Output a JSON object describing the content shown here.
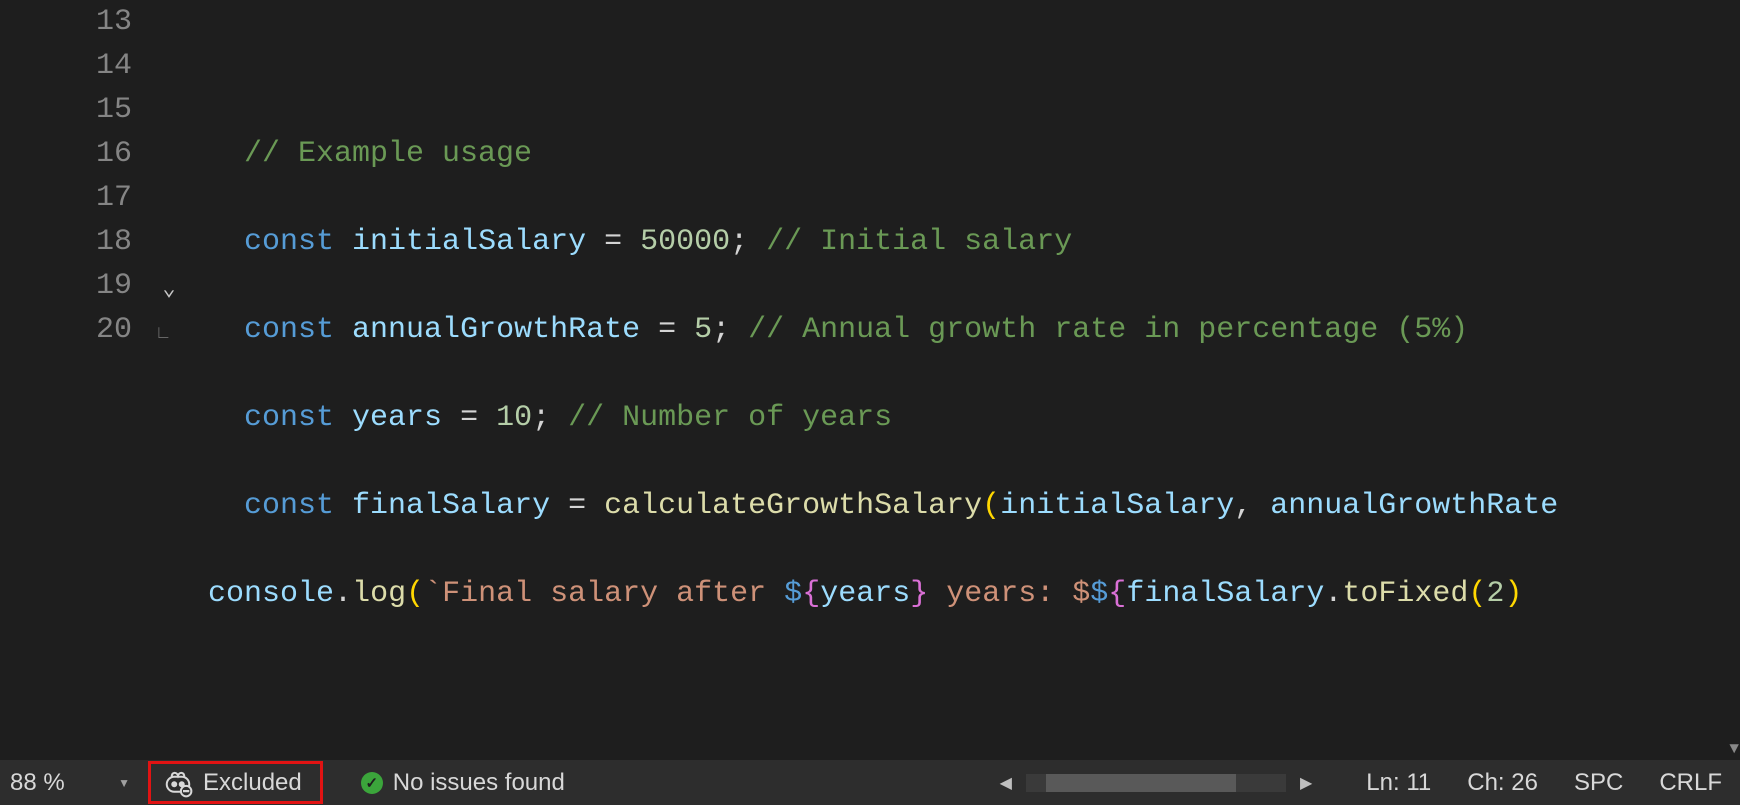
{
  "code": {
    "lines": [
      {
        "n": "13"
      },
      {
        "n": "14"
      },
      {
        "n": "15"
      },
      {
        "n": "16"
      },
      {
        "n": "17"
      },
      {
        "n": "18"
      },
      {
        "n": "19"
      },
      {
        "n": "20"
      }
    ],
    "l14_comment": "// Example usage",
    "l15_const": "const",
    "l15_name": "initialSalary",
    "l15_eq": " = ",
    "l15_val": "50000",
    "l15_semi": ";",
    "l15_cm": " // Initial salary",
    "l16_const": "const",
    "l16_name": "annualGrowthRate",
    "l16_eq": " = ",
    "l16_val": "5",
    "l16_semi": ";",
    "l16_cm": " // Annual growth rate in percentage (5%)",
    "l17_const": "const",
    "l17_name": "years",
    "l17_eq": " = ",
    "l17_val": "10",
    "l17_semi": ";",
    "l17_cm": " // Number of years",
    "l18_const": "const",
    "l18_name": "finalSalary",
    "l18_eq": " = ",
    "l18_fn": "calculateGrowthSalary",
    "l18_lp": "(",
    "l18_a1": "initialSalary",
    "l18_c1": ", ",
    "l18_a2": "annualGrowthRate",
    "l19_obj": "console",
    "l19_dot": ".",
    "l19_fn": "log",
    "l19_lp": "(",
    "l19_bt": "`",
    "l19_s1": "Final salary after ",
    "l19_d1": "$",
    "l19_lc1": "{",
    "l19_v1": "years",
    "l19_rc1": "}",
    "l19_s2": " years: ",
    "l19_ds": "$",
    "l19_d2": "$",
    "l19_lc2": "{",
    "l19_v2": "finalSalary",
    "l19_dot2": ".",
    "l19_fn2": "toFixed",
    "l19_lp2": "(",
    "l19_v3": "2",
    "l19_rp2": ")"
  },
  "statusbar": {
    "zoom": "88 %",
    "excluded_label": "Excluded",
    "issues_label": "No issues found",
    "line_label": "Ln: 11",
    "col_label": "Ch: 26",
    "indent_label": "SPC",
    "eol_label": "CRLF"
  }
}
